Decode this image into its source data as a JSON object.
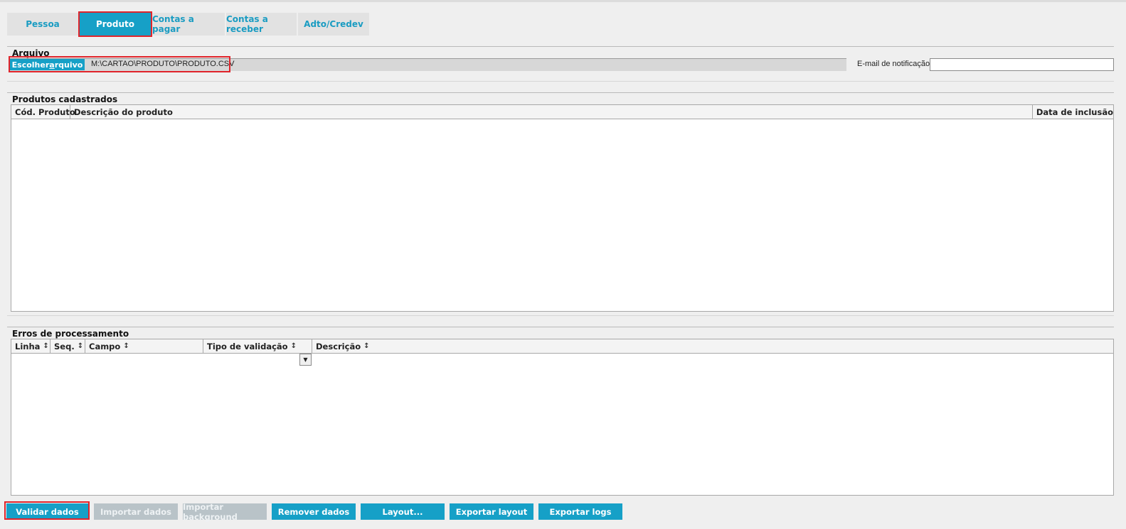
{
  "tabs": [
    {
      "label": "Pessoa"
    },
    {
      "label": "Produto"
    },
    {
      "label": "Contas a pagar"
    },
    {
      "label": "Contas a receber"
    },
    {
      "label": "Adto/Credev"
    }
  ],
  "file_section": {
    "title": "Arquivo",
    "choose_button_pre": "Escolher ",
    "choose_button_u": "a",
    "choose_button_post": "rquivo",
    "file_path": "M:\\CARTAO\\PRODUTO\\PRODUTO.CSV",
    "email_label": "E-mail de notificação",
    "email_value": ""
  },
  "products": {
    "title": "Produtos cadastrados",
    "columns": [
      "Cód. Produto",
      "Descrição do produto",
      "Data de inclusão"
    ],
    "rows": []
  },
  "errors": {
    "title": "Erros de processamento",
    "columns": [
      "Linha",
      "Seq.",
      "Campo",
      "Tipo de validação",
      "Descrição"
    ],
    "sort_icon": "↕",
    "dropdown_icon": "▼",
    "rows": []
  },
  "buttons": {
    "validar": "Validar dados",
    "importar": "Importar dados",
    "importar_bg": "Importar background",
    "remover": "Remover dados",
    "layout": "Layout...",
    "exportar_layout": "Exportar layout",
    "exportar_logs": "Exportar logs"
  },
  "colors": {
    "accent": "#16a0c7",
    "highlight": "#e0242b",
    "disabled": "#b9c3c8"
  }
}
